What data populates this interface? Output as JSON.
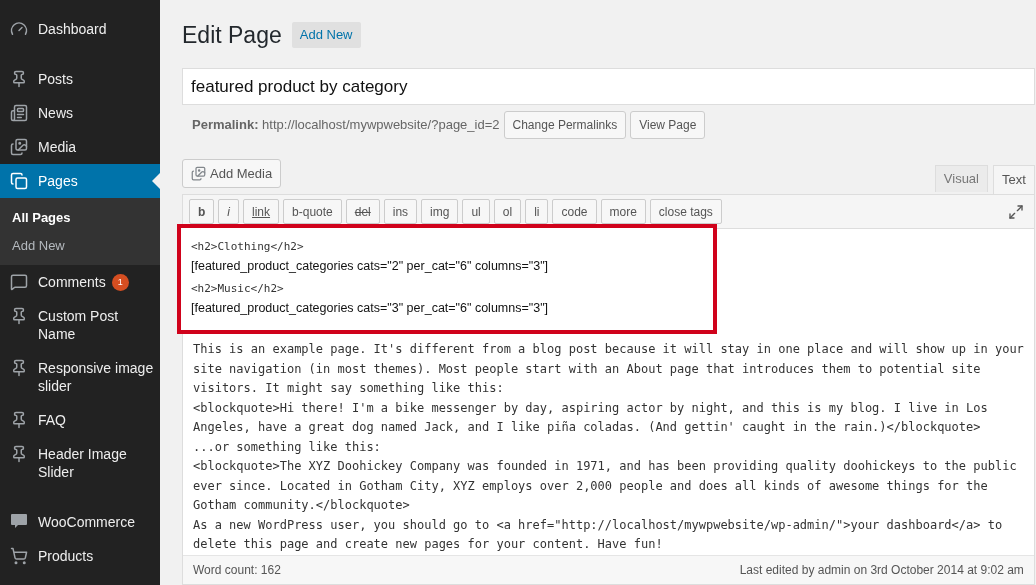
{
  "sidebar": {
    "groups": [
      [
        {
          "label": "Dashboard",
          "kind": "gauge",
          "selected": false
        }
      ],
      [
        {
          "label": "Posts",
          "kind": "pin",
          "selected": false
        },
        {
          "label": "News",
          "kind": "news",
          "selected": false
        },
        {
          "label": "Media",
          "kind": "media",
          "selected": false
        },
        {
          "label": "Pages",
          "kind": "pages",
          "selected": true,
          "children": [
            {
              "label": "All Pages",
              "selected": true
            },
            {
              "label": "Add New",
              "selected": false
            }
          ]
        },
        {
          "label": "Comments",
          "kind": "comment",
          "selected": false,
          "badge": "1"
        },
        {
          "label": "Custom Post Name",
          "kind": "pin",
          "selected": false
        },
        {
          "label": "Responsive image slider",
          "kind": "pin",
          "selected": false
        },
        {
          "label": "FAQ",
          "kind": "pin",
          "selected": false
        },
        {
          "label": "Header Image Slider",
          "kind": "pin",
          "selected": false
        }
      ],
      [
        {
          "label": "WooCommerce",
          "kind": "woo",
          "selected": false
        },
        {
          "label": "Products",
          "kind": "cart",
          "selected": false
        }
      ]
    ]
  },
  "header": {
    "title": "Edit Page",
    "add_new": "Add New"
  },
  "title_field": {
    "value": "featured product by category"
  },
  "permalink": {
    "label": "Permalink:",
    "url": "http://localhost/mywpwebsite/?page_id=2",
    "buttons": [
      "Change Permalinks",
      "View Page"
    ]
  },
  "add_media": "Add Media",
  "editor_tabs": [
    {
      "label": "Visual",
      "selected": false
    },
    {
      "label": "Text",
      "selected": true
    }
  ],
  "quicktags": [
    {
      "label": "b",
      "kind": "bold"
    },
    {
      "label": "i",
      "kind": "italic"
    },
    {
      "label": "link",
      "kind": "underline"
    },
    {
      "label": "b-quote",
      "kind": "plain"
    },
    {
      "label": "del",
      "kind": "strike"
    },
    {
      "label": "ins",
      "kind": "plain"
    },
    {
      "label": "img",
      "kind": "plain"
    },
    {
      "label": "ul",
      "kind": "plain"
    },
    {
      "label": "ol",
      "kind": "plain"
    },
    {
      "label": "li",
      "kind": "plain"
    },
    {
      "label": "code",
      "kind": "plain"
    },
    {
      "label": "more",
      "kind": "plain"
    },
    {
      "label": "close tags",
      "kind": "plain"
    }
  ],
  "highlighted_block": [
    {
      "kind": "code",
      "text": "<h2>Clothing</h2>"
    },
    {
      "kind": "shortcode",
      "text": "[featured_product_categories cats=\"2\" per_cat=\"6\" columns=\"3\"]"
    },
    {
      "kind": "code",
      "text": "<h2>Music</h2>"
    },
    {
      "kind": "shortcode",
      "text": "[featured_product_categories cats=\"3\" per_cat=\"6\" columns=\"3\"]"
    }
  ],
  "content_lines": [
    "This is an example page. It's different from a blog post because it will stay in one place and will show up in your",
    "site navigation (in most themes). Most people start with an About page that introduces them to potential site",
    "visitors. It might say something like this:",
    "<blockquote>Hi there! I'm a bike messenger by day, aspiring actor by night, and this is my blog. I live in Los",
    "Angeles, have a great dog named Jack, and I like piña coladas. (And gettin' caught in the rain.)</blockquote>",
    "...or something like this:",
    "<blockquote>The XYZ Doohickey Company was founded in 1971, and has been providing quality doohickeys to the public",
    "ever since. Located in Gotham City, XYZ employs over 2,000 people and does all kinds of awesome things for the",
    "Gotham community.</blockquote>",
    "As a new WordPress user, you should go to <a href=\"http://localhost/mywpwebsite/wp-admin/\">your dashboard</a> to",
    "delete this page and create new pages for your content. Have fun!"
  ],
  "status_bar": {
    "word_count": "Word count: 162",
    "last_edited": "Last edited by admin on 3rd October 2014 at 9:02 am"
  }
}
